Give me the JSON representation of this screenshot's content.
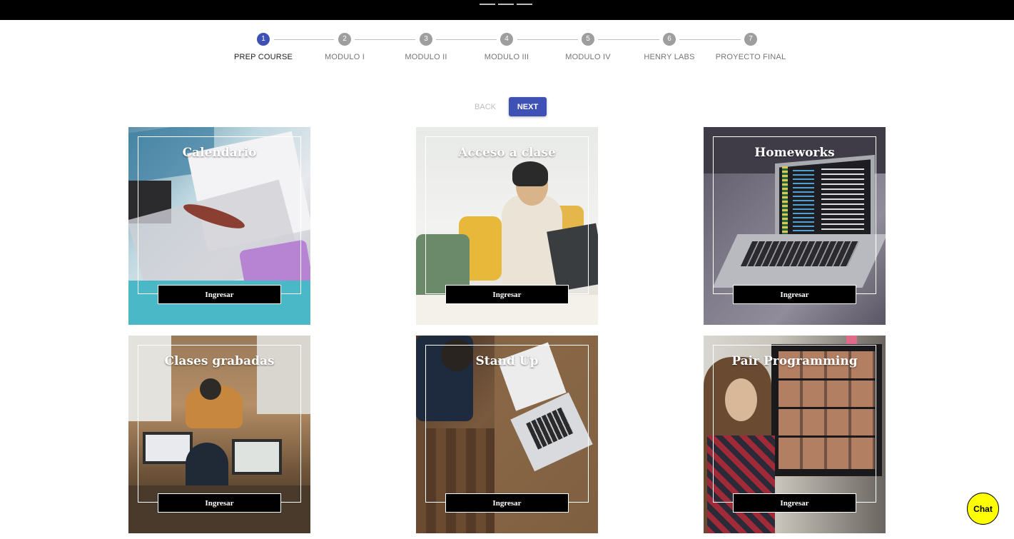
{
  "steps": [
    {
      "num": "1",
      "label": "PREP COURSE"
    },
    {
      "num": "2",
      "label": "MODULO I"
    },
    {
      "num": "3",
      "label": "MODULO II"
    },
    {
      "num": "4",
      "label": "MODULO III"
    },
    {
      "num": "5",
      "label": "MODULO IV"
    },
    {
      "num": "6",
      "label": "HENRY LABS"
    },
    {
      "num": "7",
      "label": "PROYECTO FINAL"
    }
  ],
  "active_step": 1,
  "nav": {
    "back_label": "BACK",
    "next_label": "NEXT"
  },
  "cards": [
    {
      "title": "Calendario",
      "button": "Ingresar"
    },
    {
      "title": "Acceso a clase",
      "button": "Ingresar"
    },
    {
      "title": "Homeworks",
      "button": "Ingresar"
    },
    {
      "title": "Clases grabadas",
      "button": "Ingresar"
    },
    {
      "title": "Stand Up",
      "button": "Ingresar"
    },
    {
      "title": "Pair Programming",
      "button": "Ingresar"
    }
  ],
  "chat": {
    "label": "Chat"
  },
  "colors": {
    "accent": "#3f51b5",
    "chat": "#ffff00",
    "topbar": "#000000"
  }
}
